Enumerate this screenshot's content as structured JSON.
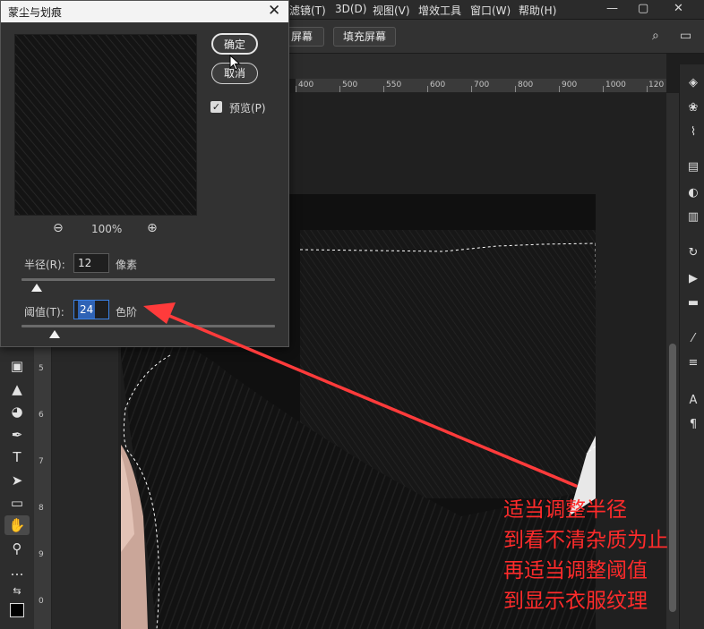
{
  "menubar": {
    "items": [
      "滤镜(T)",
      "3D(D)",
      "视图(V)",
      "增效工具",
      "窗口(W)",
      "帮助(H)"
    ]
  },
  "options_bar": {
    "fill_screen_label": "屏幕",
    "fill_screen2_label": "填充屏幕"
  },
  "ruler": {
    "top_labels": [
      "400",
      "500",
      "550",
      "600",
      "700",
      "800",
      "900",
      "1000",
      "1100",
      "120"
    ],
    "left_labels": [
      "0",
      "5",
      "6",
      "7",
      "8",
      "9"
    ]
  },
  "dialog": {
    "title": "蒙尘与划痕",
    "ok_label": "确定",
    "cancel_label": "取消",
    "preview_label": "预览(P)",
    "preview_checked": true,
    "zoom_value": "100%",
    "radius": {
      "label": "半径(R):",
      "value": "12",
      "unit": "像素",
      "slider_fraction": 0.06
    },
    "threshold": {
      "label": "阈值(T):",
      "value": "24",
      "unit": "色阶",
      "slider_fraction": 0.13
    }
  },
  "annotation": {
    "lines": [
      "适当调整半径",
      "到看不清杂质为止",
      "再适当调整阈值",
      "到显示衣服纹理"
    ],
    "color": "#ff2b2b"
  },
  "icons": {
    "tools": [
      "gradient-icon",
      "sharpen-icon",
      "dodge-icon",
      "pen-icon",
      "type-icon",
      "path-select-icon",
      "rectangle-icon",
      "hand-icon",
      "zoom-icon",
      "more-icon",
      "swap-colors-icon",
      "color-swatch-icon"
    ],
    "panels": [
      "layers-icon",
      "channels-icon",
      "paths-icon",
      "properties-icon",
      "adjustments-icon",
      "libraries-icon",
      "history-icon",
      "actions-icon",
      "comments-icon",
      "brush-settings-icon",
      "sliders-icon",
      "character-icon",
      "paragraph-icon"
    ]
  }
}
